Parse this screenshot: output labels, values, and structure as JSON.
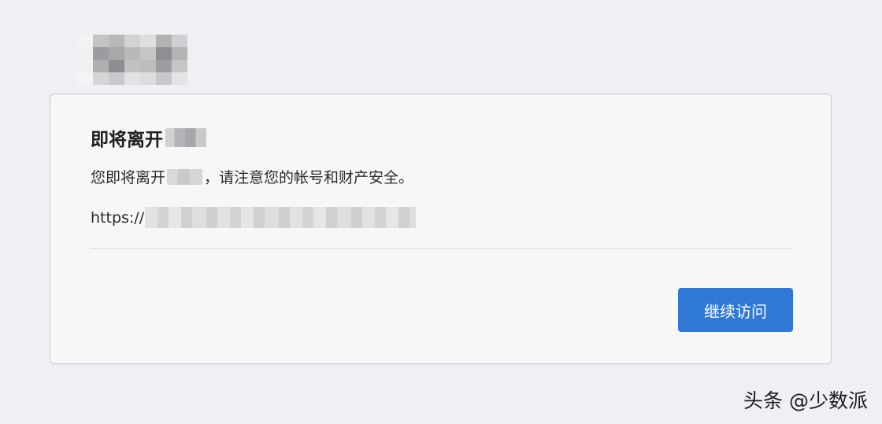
{
  "dialog": {
    "title": "即将离开",
    "message_prefix": "您即将离开",
    "message_suffix": "，请注意您的帐号和财产安全。",
    "url_prefix": "https://",
    "continue_button": "继续访问"
  },
  "watermark": "头条 @少数派",
  "colors": {
    "background": "#eff0f4",
    "card": "#f7f7f8",
    "button": "#2f78d6"
  }
}
